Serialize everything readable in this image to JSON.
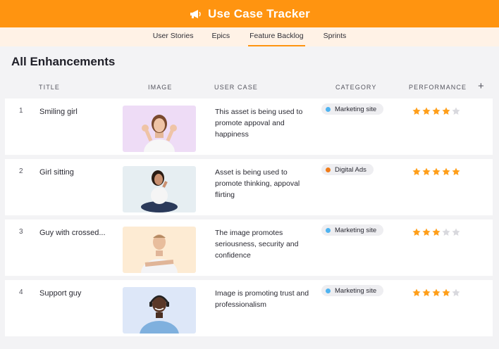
{
  "app": {
    "title": "Use Case Tracker",
    "icon": "megaphone-icon",
    "accent": "#ff9410"
  },
  "nav": {
    "tabs": [
      {
        "label": "User Stories"
      },
      {
        "label": "Epics"
      },
      {
        "label": "Feature Backlog",
        "active": true
      },
      {
        "label": "Sprints"
      }
    ]
  },
  "page": {
    "title": "All Enhancements"
  },
  "table": {
    "columns": [
      "TITLE",
      "IMAGE",
      "USER CASE",
      "CATEGORY",
      "PERFORMANCE"
    ],
    "add_icon": "+",
    "rows": [
      {
        "num": "1",
        "title": "Smiling girl",
        "image": "smiling-girl-photo",
        "user_case": "This asset is being used to promote appoval and happiness",
        "category": "Marketing site",
        "category_color": "#4fb3f0",
        "rating": 4
      },
      {
        "num": "2",
        "title": "Girl sitting",
        "image": "girl-sitting-photo",
        "user_case": "Asset is being used to promote thinking, appoval flirting",
        "category": "Digital Ads",
        "category_color": "#f07c1a",
        "rating": 5
      },
      {
        "num": "3",
        "title": "Guy with crossed...",
        "image": "guy-crossed-arms-photo",
        "user_case": "The image promotes seriousness, security and confidence",
        "category": "Marketing site",
        "category_color": "#4fb3f0",
        "rating": 3
      },
      {
        "num": "4",
        "title": "Support guy",
        "image": "support-guy-photo",
        "user_case": "Image is promoting trust and professionalism",
        "category": "Marketing site",
        "category_color": "#4fb3f0",
        "rating": 4
      }
    ],
    "rating_max": 5,
    "star_on_color": "#ff9f1a",
    "star_off_color": "#d9d9de"
  }
}
